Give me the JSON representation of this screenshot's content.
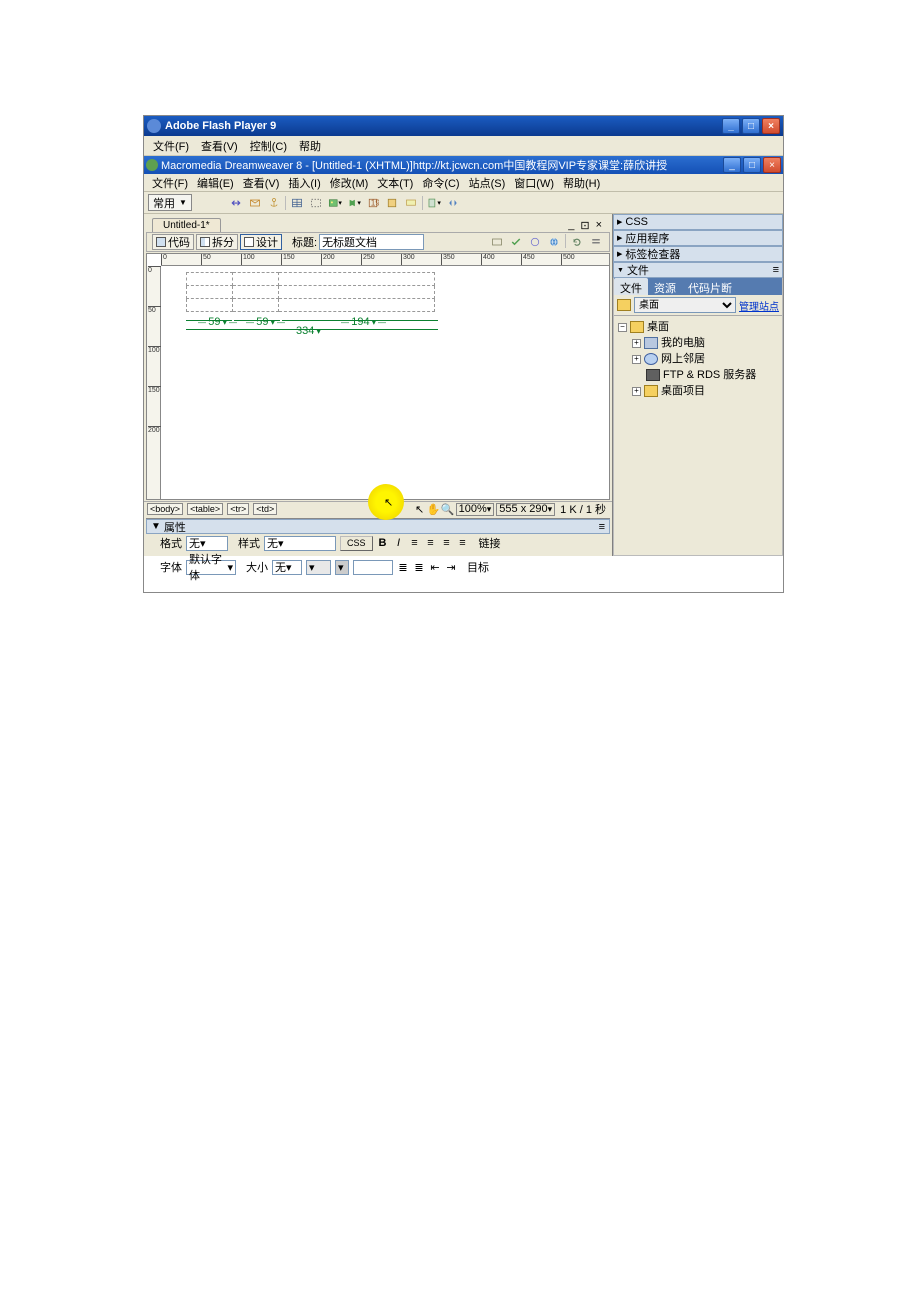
{
  "outer_window": {
    "title": "Adobe Flash Player 9",
    "menu": [
      "文件(F)",
      "查看(V)",
      "控制(C)",
      "帮助"
    ]
  },
  "dw_window": {
    "title": "Macromedia Dreamweaver 8 - [Untitled-1 (XHTML)]http://kt.jcwcn.com中国教程网VIP专家课堂:薛欣讲授",
    "menu": [
      "文件(F)",
      "编辑(E)",
      "查看(V)",
      "插入(I)",
      "修改(M)",
      "文本(T)",
      "命令(C)",
      "站点(S)",
      "窗口(W)",
      "帮助(H)"
    ]
  },
  "toolbar": {
    "category": "常用"
  },
  "doc": {
    "tab": "Untitled-1*",
    "views": {
      "code": "代码",
      "split": "拆分",
      "design": "设计"
    },
    "title_label": "标题:",
    "title_value": "无标题文档"
  },
  "ruler_marks": [
    "0",
    "50",
    "100",
    "150",
    "200",
    "250",
    "300",
    "350",
    "400",
    "450",
    "500"
  ],
  "col_marks": {
    "c1": "59",
    "c2": "59",
    "c3": "194",
    "total": "334"
  },
  "status": {
    "path": [
      "<body>",
      "<table>",
      "<tr>",
      "<td>"
    ],
    "zoom": "100%",
    "size": "555 x 290",
    "weight": "1 K / 1 秒"
  },
  "properties": {
    "title": "属性",
    "format_label": "格式",
    "format_value": "无",
    "style_label": "样式",
    "style_value": "无",
    "css_btn": "CSS",
    "link_label": "链接",
    "font_label": "字体",
    "font_value": "默认字体",
    "size_label": "大小",
    "size_value": "无",
    "target_label": "目标"
  },
  "panels": {
    "css": "CSS",
    "app": "应用程序",
    "tag": "标签检查器",
    "files": "文件",
    "files_tabs": {
      "files": "文件",
      "assets": "资源",
      "snippets": "代码片断"
    },
    "site_select": "桌面",
    "manage_link": "管理站点",
    "tree": {
      "root": "桌面",
      "nodes": [
        "我的电脑",
        "网上邻居",
        "FTP & RDS 服务器",
        "桌面项目"
      ]
    }
  }
}
